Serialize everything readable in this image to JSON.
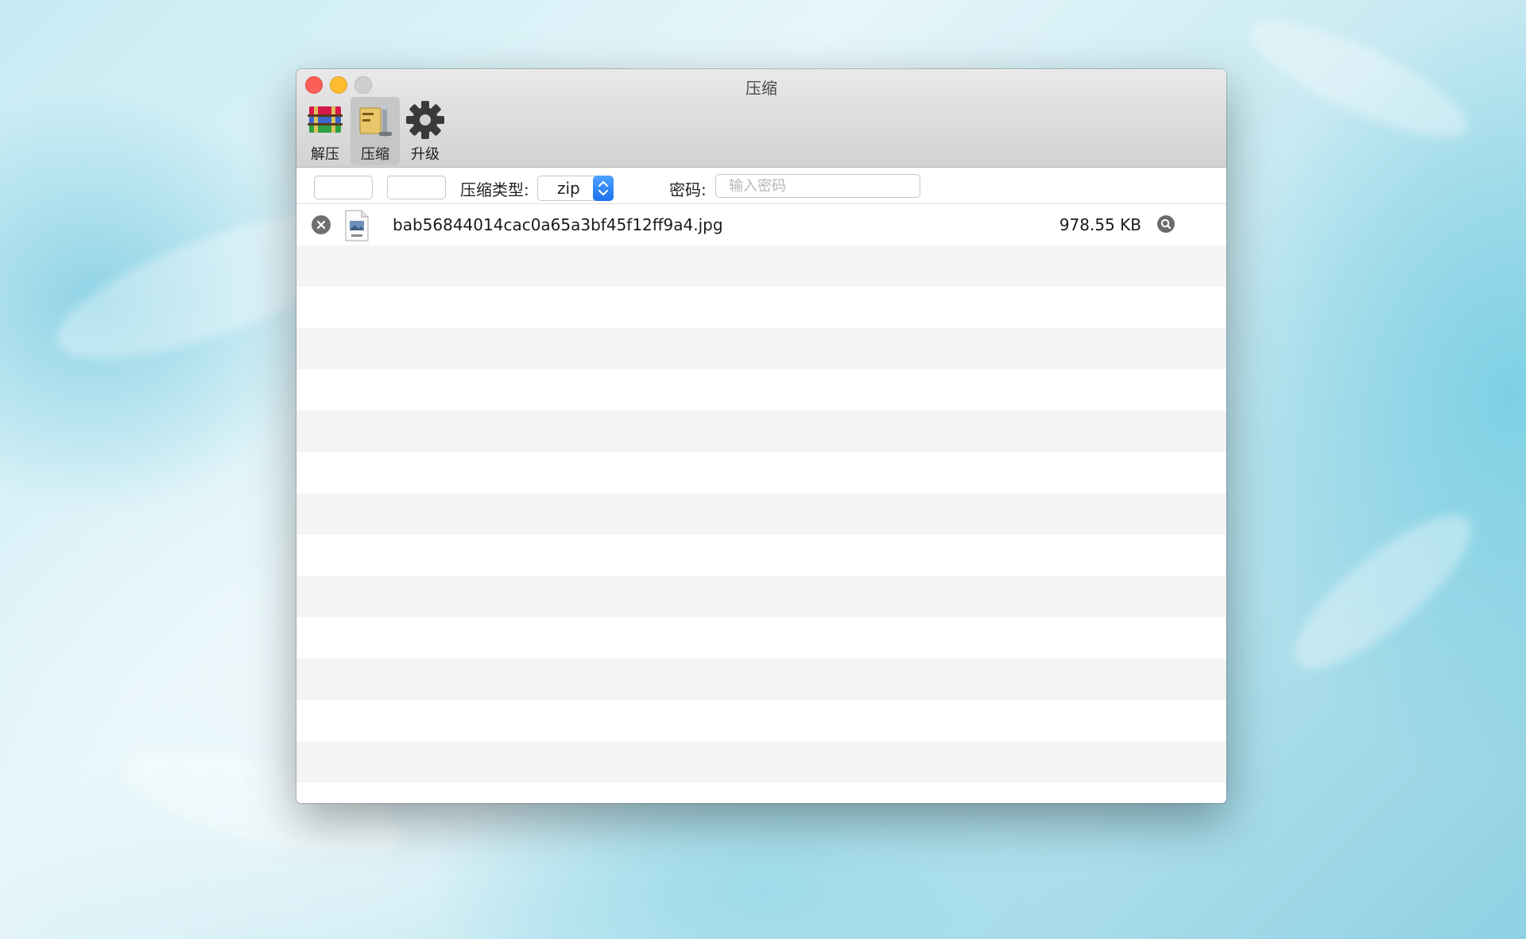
{
  "window": {
    "title": "压缩"
  },
  "toolbar": {
    "items": [
      {
        "label": "解压",
        "icon": "rar-books-icon",
        "active": false
      },
      {
        "label": "压缩",
        "icon": "compress-vise-icon",
        "active": true
      },
      {
        "label": "升级",
        "icon": "gear-icon",
        "active": false
      }
    ]
  },
  "options": {
    "compress_type_label": "压缩类型:",
    "compress_type_value": "zip",
    "password_label": "密码:",
    "password_placeholder": "输入密码",
    "password_value": ""
  },
  "files": [
    {
      "name": "bab56844014cac0a65a3bf45f12ff9a4.jpg",
      "size": "978.55 KB",
      "type_icon": "jpeg-file-icon"
    }
  ],
  "colors": {
    "close": "#fd5f57",
    "minimize": "#febc2e",
    "zoom_disabled": "#cfcfcf",
    "select_accent": "#1c72f0",
    "stripe": "#f4f4f4"
  }
}
